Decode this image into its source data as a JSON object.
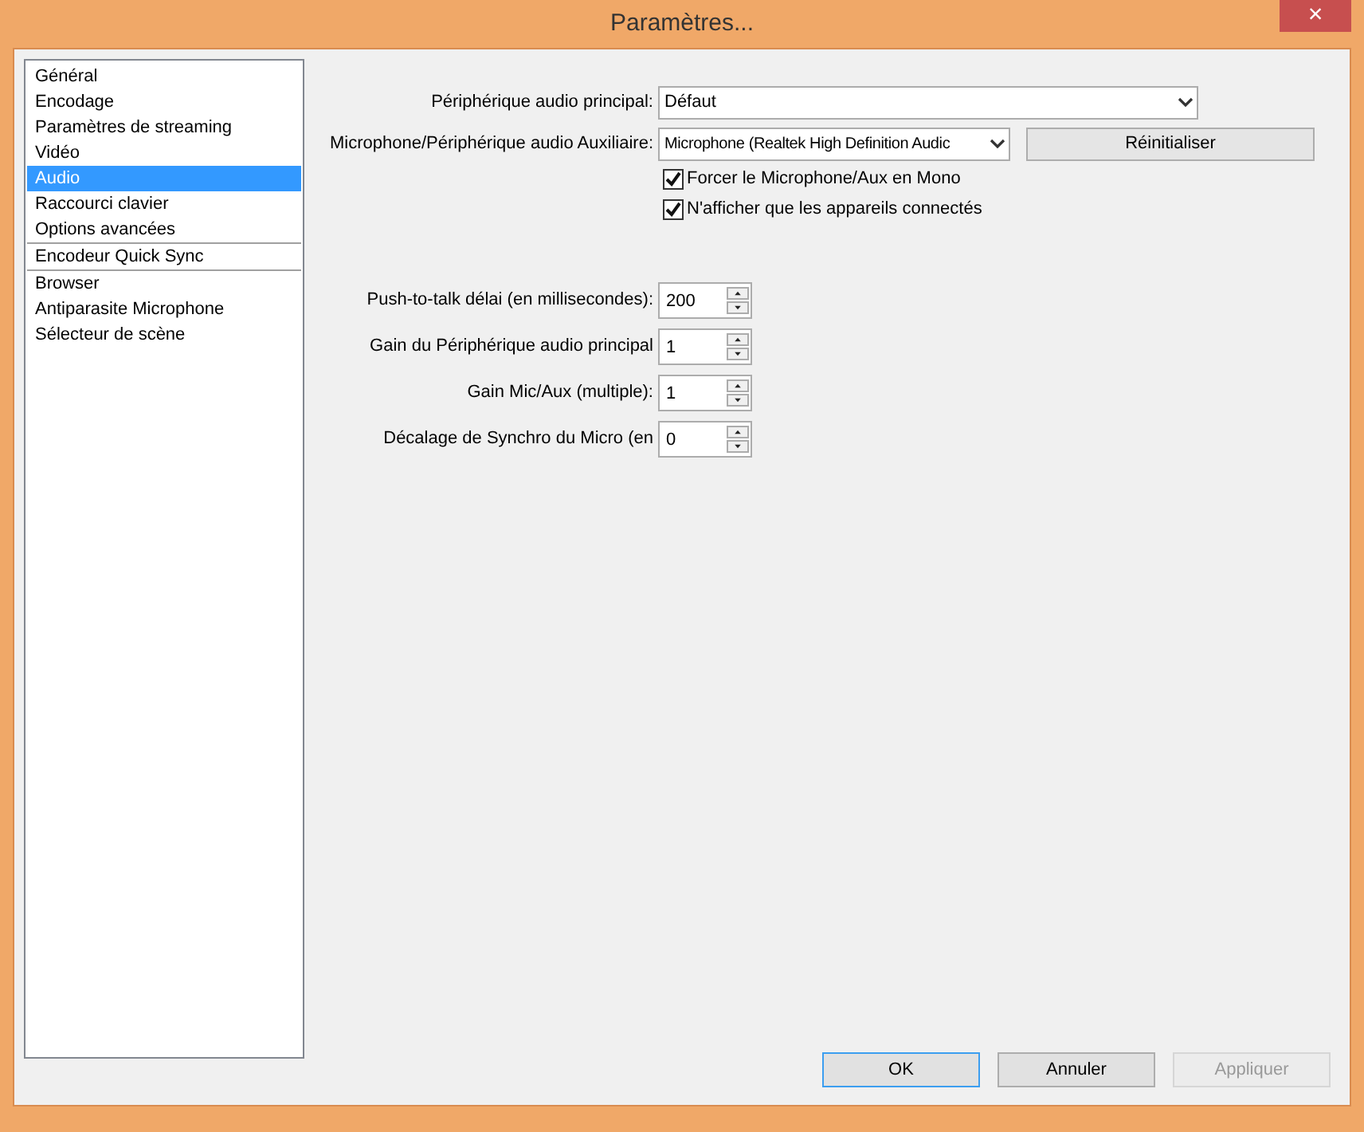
{
  "window": {
    "title": "Paramètres...",
    "close": "×"
  },
  "sidebar": {
    "groups": [
      {
        "items": [
          {
            "label": "Général",
            "selected": false
          },
          {
            "label": "Encodage",
            "selected": false
          },
          {
            "label": "Paramètres de streaming",
            "selected": false
          },
          {
            "label": "Vidéo",
            "selected": false
          },
          {
            "label": "Audio",
            "selected": true
          },
          {
            "label": "Raccourci clavier",
            "selected": false
          },
          {
            "label": "Options avancées",
            "selected": false
          }
        ]
      },
      {
        "items": [
          {
            "label": "Encodeur Quick Sync",
            "selected": false
          }
        ]
      },
      {
        "items": [
          {
            "label": "Browser",
            "selected": false
          },
          {
            "label": "Antiparasite Microphone",
            "selected": false
          },
          {
            "label": "Sélecteur de scène",
            "selected": false
          }
        ]
      }
    ]
  },
  "devices": [
    {
      "label": "Périphérique audio principal:",
      "value": "Défaut"
    },
    {
      "label": "Microphone/Périphérique audio Auxiliaire:",
      "value": "Microphone (Realtek High Definition Audic",
      "button": "Réinitialiser"
    }
  ],
  "checkboxes": [
    {
      "label": "Forcer le Microphone/Aux en Mono",
      "checked": true
    },
    {
      "label": "N'afficher que les appareils connectés",
      "checked": true
    }
  ],
  "spinners": [
    {
      "label": "Push-to-talk délai (en millisecondes):",
      "value": "200"
    },
    {
      "label": "Gain du Périphérique audio principal",
      "value": "1"
    },
    {
      "label": "Gain Mic/Aux (multiple):",
      "value": "1"
    },
    {
      "label": "Décalage de Synchro du Micro (en",
      "value": "0"
    }
  ],
  "buttons": [
    {
      "label": "OK",
      "default": true,
      "disabled": false
    },
    {
      "label": "Annuler",
      "default": false,
      "disabled": false
    },
    {
      "label": "Appliquer",
      "default": false,
      "disabled": true
    }
  ]
}
